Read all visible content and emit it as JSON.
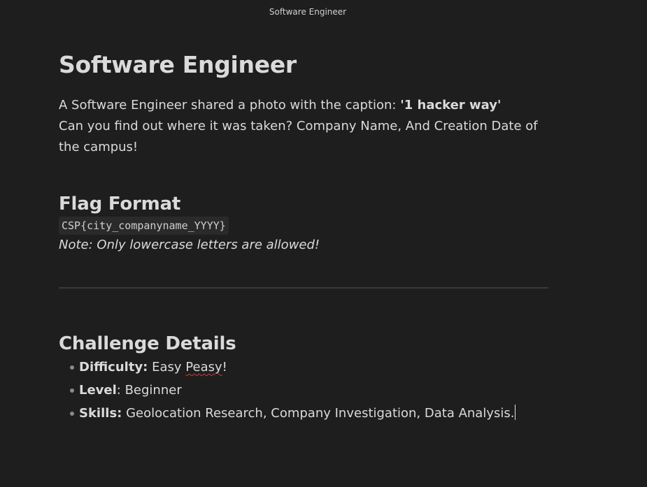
{
  "window": {
    "title": "Software Engineer"
  },
  "document": {
    "heading": "Software Engineer",
    "intro_prefix": "A Software Engineer shared a photo with the caption: ",
    "caption_quote": "'1 hacker way'",
    "intro_question": "Can you find out where it was taken? Company Name, And Creation Date of the campus!",
    "flag_section": {
      "heading": "Flag Format",
      "format_code": "CSP{city_companyname_YYYY}",
      "note": "Note: Only lowercase letters are allowed!"
    },
    "details_section": {
      "heading": "Challenge Details",
      "items": [
        {
          "label": "Difficulty:",
          "value_plain": " Easy ",
          "value_flagged": "Peasy",
          "value_tail": "!"
        },
        {
          "label": "Level",
          "value": ": Beginner"
        },
        {
          "label": "Skills:",
          "value": " Geolocation Research, Company Investigation, Data Analysis."
        }
      ]
    }
  },
  "colors": {
    "background": "#1e1e1e",
    "text": "#dadada",
    "code_background": "#2a2a2a",
    "divider": "#3a3a3a",
    "spellcheck": "#d13b3b"
  }
}
